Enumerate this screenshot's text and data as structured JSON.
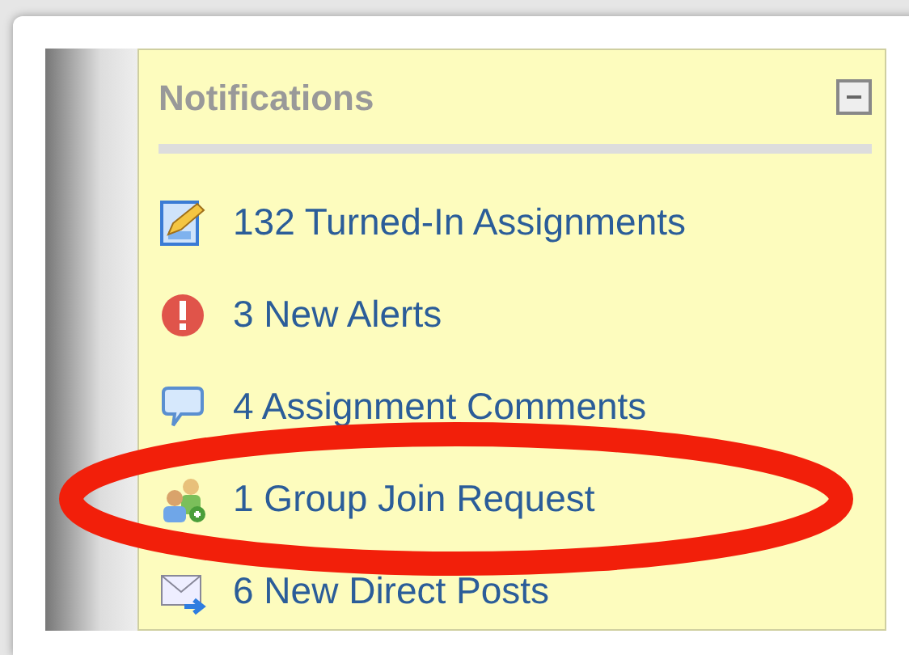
{
  "panel": {
    "title": "Notifications",
    "collapse_symbol": "−"
  },
  "items": [
    {
      "kind": "assignment",
      "label": "132 Turned-In Assignments"
    },
    {
      "kind": "alert",
      "label": "3 New Alerts"
    },
    {
      "kind": "comment",
      "label": "4 Assignment Comments"
    },
    {
      "kind": "group",
      "label": "1 Group Join Request",
      "highlighted": true
    },
    {
      "kind": "post",
      "label": "6 New Direct Posts"
    }
  ]
}
